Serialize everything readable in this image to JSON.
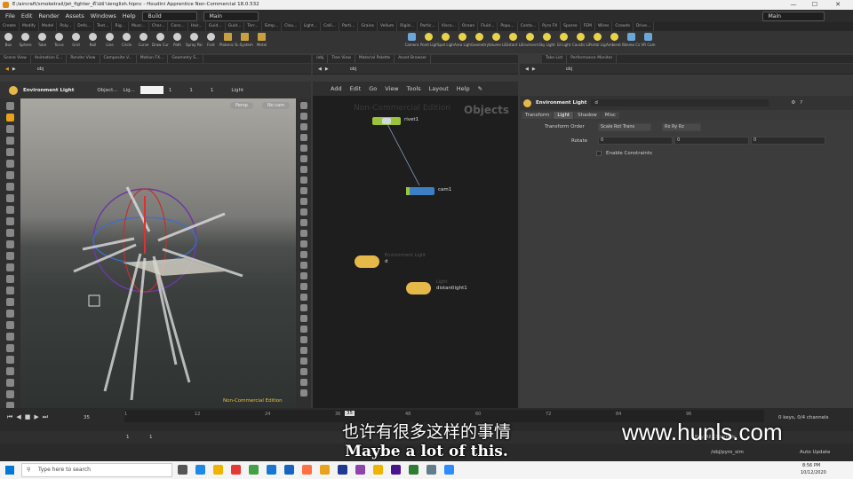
{
  "window": {
    "title": "E:/aircraft/smoketrail/jet_fighter_ตัวอย่างenglish.hipnc - Houdini Apprentice Non-Commercial 18.0.532",
    "minimize": "—",
    "maximize": "☐",
    "close": "✕"
  },
  "menu": [
    "File",
    "Edit",
    "Render",
    "Assets",
    "Windows",
    "Help"
  ],
  "desktop_build": "Build",
  "desktop_main": "Main",
  "desktop_right": "Main",
  "shelf_tabs": [
    "Create",
    "Modify",
    "Model",
    "Poly...",
    "Defo...",
    "Text...",
    "Rig...",
    "Musc...",
    "Char...",
    "Cons...",
    "Hair...",
    "Guid...",
    "Guid...",
    "Terr...",
    "Simp...",
    "Clou...",
    "Light...",
    "Colli...",
    "Parti...",
    "Grains",
    "Vellum",
    "Rigid...",
    "Partic...",
    "Visco...",
    "Ocean",
    "Fluid...",
    "Popu...",
    "Conta...",
    "Pyro FX",
    "Sparse",
    "FEM",
    "Wires",
    "Crowds",
    "Drive..."
  ],
  "shelf_tools_left": [
    "Box",
    "Sphere",
    "Tube",
    "Torus",
    "Grid",
    "Null",
    "Line",
    "Circle",
    "Curve",
    "Draw Curve",
    "Path",
    "Spray Paint",
    "Font",
    "Platonic Solids",
    "L-System",
    "Metal"
  ],
  "shelf_tools_right": [
    "Camera",
    "Point Light",
    "Spot Light",
    "Area Light",
    "Geometry Light",
    "Volume Light",
    "Distant Light",
    "Environment Light",
    "Sky Light",
    "GI Light",
    "Caustic Light",
    "Portal Light",
    "Ambient Light",
    "Stereo Camera",
    "VR Cam"
  ],
  "pane_tabs_left": [
    "Scene View",
    "Animation E...",
    "Render View",
    "Composite V...",
    "Motion FX...",
    "Geometry S..."
  ],
  "pane_tabs_mid": [
    "/obj",
    "Tree View",
    "Material Palette",
    "Asset Browser"
  ],
  "pane_tabs_right": [
    "Take List",
    "Performance Monitor"
  ],
  "path_obj": "obj",
  "viewport_toolbar": {
    "node": "Environment Light",
    "object": "Object...",
    "light": "Lig...",
    "val1": "1",
    "val2": "1",
    "val3": "1",
    "light_menu": "Light"
  },
  "viewport_buttons": {
    "persp": "Persp",
    "nocam": "No cam"
  },
  "viewport_watermark": "Non-Commercial Edition",
  "network_menu": [
    "Add",
    "Edit",
    "Go",
    "View",
    "Tools",
    "Layout",
    "Help"
  ],
  "network_watermark": "Non-Commercial Edition",
  "network_context": "Objects",
  "nodes": [
    {
      "name": "rivet1"
    },
    {
      "name": "cam1"
    },
    {
      "name": "d",
      "type": "Environment Light"
    },
    {
      "name": "distantlight1",
      "type": "Light"
    }
  ],
  "params": {
    "node_type": "Environment Light",
    "node_name": "d",
    "tabs": [
      "Transform",
      "Light",
      "Shadow",
      "Misc"
    ],
    "active_tab": "Light",
    "transform_order_label": "Transform Order",
    "transform_order": "Scale Rot Trans",
    "rotate_order": "Rx Ry Rz",
    "rotate_label": "Rotate",
    "rotate_values": [
      "0",
      "0",
      "0"
    ],
    "enable_constraints": "Enable Constraints"
  },
  "timeline": {
    "frame": "35",
    "current_marker": "35",
    "ticks": [
      "1",
      "12",
      "24",
      "36",
      "48",
      "60",
      "72",
      "84",
      "96"
    ],
    "start": "1",
    "end": "1",
    "keys_info": "0 keys, 0/4 channels",
    "key_all": "Key All Channels",
    "path": "/obj/pyro_sim",
    "auto_update": "Auto Update"
  },
  "subtitle_cn": "也许有很多这样的事情",
  "subtitle_en": "Maybe a lot of this.",
  "watermark": "www.hunls.com",
  "taskbar": {
    "search_placeholder": "Type here to search",
    "time": "8:56 PM",
    "date": "10/12/2020"
  },
  "colors": {
    "accent": "#e8a21b",
    "node_blue": "#3d7fc4",
    "node_yellow": "#e6b84a",
    "node_green": "#9cc33a"
  }
}
